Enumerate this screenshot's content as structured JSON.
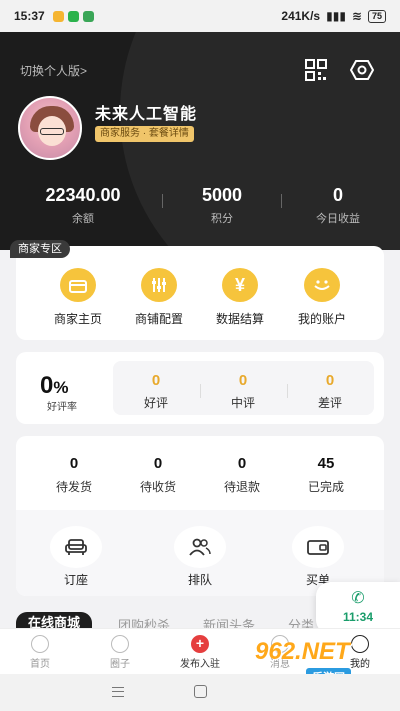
{
  "status_bar": {
    "time": "15:37",
    "network_speed": "241K/s",
    "battery": "75"
  },
  "header": {
    "switch_label": "切换个人版>",
    "shop_name": "未来人工智能",
    "merchant_tag": "商家服务 · 套餐详情",
    "stats": [
      {
        "value": "22340.00",
        "label": "余额"
      },
      {
        "value": "5000",
        "label": "积分"
      },
      {
        "value": "0",
        "label": "今日收益"
      }
    ]
  },
  "merchant_zone": {
    "tag": "商家专区",
    "items": [
      {
        "label": "商家主页",
        "icon": "shop-icon"
      },
      {
        "label": "商铺配置",
        "icon": "sliders-icon"
      },
      {
        "label": "数据结算",
        "icon": "yen-icon"
      },
      {
        "label": "我的账户",
        "icon": "smile-icon"
      }
    ]
  },
  "rating": {
    "percent": "0",
    "percent_sign": "%",
    "label": "好评率",
    "items": [
      {
        "value": "0",
        "label": "好评"
      },
      {
        "value": "0",
        "label": "中评"
      },
      {
        "value": "0",
        "label": "差评"
      }
    ]
  },
  "orders": {
    "items": [
      {
        "value": "0",
        "label": "待发货"
      },
      {
        "value": "0",
        "label": "待收货"
      },
      {
        "value": "0",
        "label": "待退款"
      },
      {
        "value": "45",
        "label": "已完成"
      }
    ],
    "tools": [
      {
        "label": "订座",
        "icon": "sofa-icon"
      },
      {
        "label": "排队",
        "icon": "people-icon"
      },
      {
        "label": "买单",
        "icon": "wallet-icon"
      }
    ]
  },
  "tabs": [
    "在线商城",
    "团购秒杀",
    "新闻头条",
    "分类"
  ],
  "bottom_nav": [
    {
      "label": "首页",
      "icon": "home-icon"
    },
    {
      "label": "圈子",
      "icon": "chat-icon"
    },
    {
      "label": "发布入驻",
      "icon": "plus-icon"
    },
    {
      "label": "消息",
      "icon": "message-icon"
    },
    {
      "label": "我的",
      "icon": "profile-icon"
    }
  ],
  "call_widget": {
    "time": "11:34",
    "icon": "phone-icon"
  },
  "watermark": {
    "number": "962.NET",
    "text": "乐游网"
  },
  "colors": {
    "accent": "#f6c43c",
    "header_bg": "#1c1c1c",
    "rating_value": "#e8a92c",
    "publish": "#e53e3e",
    "call": "#1a9d6b"
  }
}
